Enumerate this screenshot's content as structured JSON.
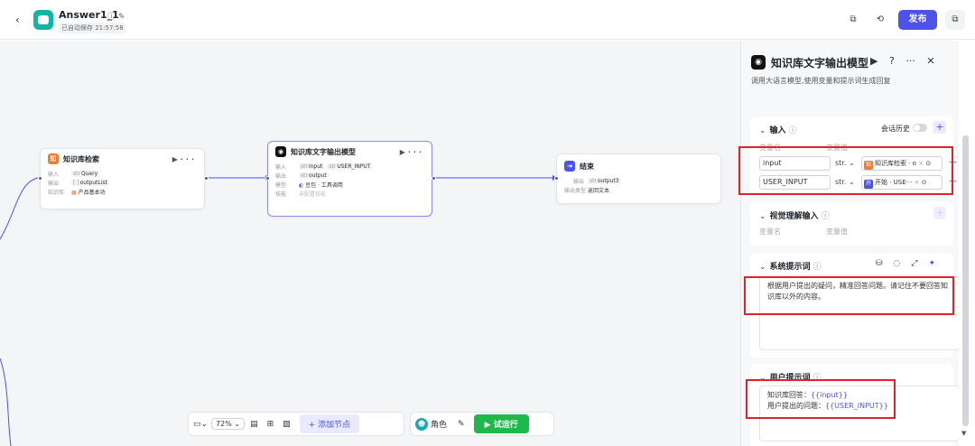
{
  "header": {
    "app_name": "Answer1_1",
    "autosave": "已自动保存 21:57:58",
    "publish_label": "发布"
  },
  "canvas": {
    "nodes": {
      "kb": {
        "title": "知识库检索",
        "input_label": "输入",
        "input_tag_type": "str",
        "input_tag": "Query",
        "output_label": "输出",
        "output_tag_type": "[ ]",
        "output_tag": "outputList",
        "kb_label": "知识库",
        "kb_value": "产品基本功"
      },
      "llm": {
        "title": "知识库文字输出模型",
        "input_label": "输入",
        "input_tags": [
          {
            "type": "str",
            "name": "input"
          },
          {
            "type": "str",
            "name": "USER_INPUT"
          }
        ],
        "output_label": "输出",
        "output_tag_type": "str",
        "output_tag": "output",
        "model_label": "模型",
        "model_value": "豆包 · 工具调用",
        "skill_label": "技能",
        "skill_value": "未配置技能"
      },
      "end": {
        "title": "结束",
        "output_label": "输出",
        "output_tag_type": "str",
        "output_tag": "output3",
        "output_type_label": "输出类型",
        "output_type_value": "返回文本"
      }
    },
    "toolbar": {
      "zoom": "72%",
      "add_node": "+ 添加节点",
      "role": "角色",
      "run": "▶ 试运行"
    }
  },
  "panel": {
    "title": "知识库文字输出模型",
    "description": "调用大语言模型,使用变量和提示词生成回复",
    "input_section": {
      "title": "输入",
      "history_label": "会话历史",
      "col_name": "变量名",
      "col_value": "变量值",
      "rows": [
        {
          "name": "input",
          "type": "str.",
          "ref": "知识库检索 · o",
          "ref_color": "#f07c2a",
          "ref_icon": "知"
        },
        {
          "name": "USER_INPUT",
          "type": "str.",
          "ref": "开始 · USE···",
          "ref_color": "#4d53e8",
          "ref_icon": "开"
        }
      ]
    },
    "vision_section": {
      "title": "视觉理解输入",
      "col_name": "变量名",
      "col_value": "变量值"
    },
    "system_prompt": {
      "title": "系统提示词",
      "text": "根据用户提出的疑问，精准回答问题。请记住不要回答知识库以外的内容。"
    },
    "user_prompt": {
      "title": "用户提示词",
      "line1_label": "知识库回答：",
      "line1_var": "{{input}}",
      "line2_label": "用户提出的问题：",
      "line2_var": "{{USER_INPUT}}"
    }
  }
}
